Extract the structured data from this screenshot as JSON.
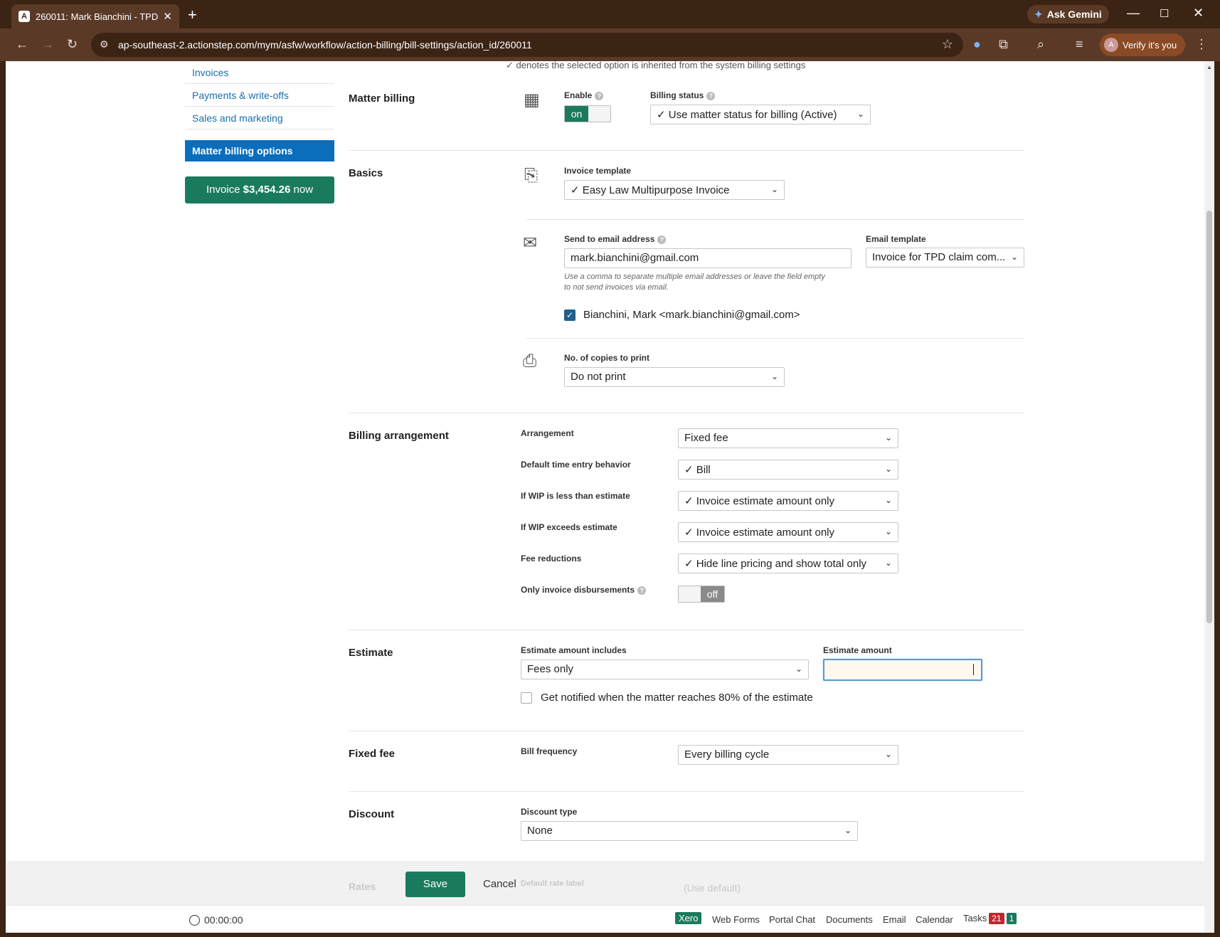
{
  "browser": {
    "tab_title": "260011: Mark Bianchini - TPD (",
    "url": "ap-southeast-2.actionstep.com/mym/asfw/workflow/action-billing/bill-settings/action_id/260011",
    "gemini_label": "Ask Gemini",
    "verify_label": "Verify it's you",
    "avatar_letter": "A"
  },
  "sidebar": {
    "items": [
      {
        "label": "Invoices"
      },
      {
        "label": "Payments & write-offs"
      },
      {
        "label": "Sales and marketing"
      },
      {
        "label": "Matter billing options"
      }
    ],
    "invoice_button": {
      "prefix": "Invoice ",
      "amount": "$3,454.26",
      "suffix": " now"
    }
  },
  "note": "✓ denotes the selected option is inherited from the system billing settings",
  "matter_billing": {
    "title": "Matter billing",
    "enable_label": "Enable",
    "enable_value": "on",
    "status_label": "Billing status",
    "status_value": "✓ Use matter status for billing (Active)"
  },
  "basics": {
    "title": "Basics",
    "template_label": "Invoice template",
    "template_value": "✓ Easy Law Multipurpose Invoice",
    "email_label": "Send to email address",
    "email_value": "mark.bianchini@gmail.com",
    "email_help_1": "Use a comma to separate multiple email addresses or leave the field empty",
    "email_help_2": "to not send invoices via email.",
    "email_template_label": "Email template",
    "email_template_value": "Invoice for TPD claim com...",
    "contact_checkbox": "Bianchini, Mark <mark.bianchini@gmail.com>",
    "copies_label": "No. of copies to print",
    "copies_value": "Do not print"
  },
  "billing_arrangement": {
    "title": "Billing arrangement",
    "rows": [
      {
        "label": "Arrangement",
        "value": "Fixed fee"
      },
      {
        "label": "Default time entry behavior",
        "value": "✓ Bill"
      },
      {
        "label": "If WIP is less than estimate",
        "value": "✓ Invoice estimate amount only"
      },
      {
        "label": "If WIP exceeds estimate",
        "value": "✓ Invoice estimate amount only"
      },
      {
        "label": "Fee reductions",
        "value": "✓ Hide line pricing and show total only"
      }
    ],
    "disb_label": "Only invoice disbursements",
    "disb_value": "off"
  },
  "estimate": {
    "title": "Estimate",
    "includes_label": "Estimate amount includes",
    "includes_value": "Fees only",
    "amount_label": "Estimate amount",
    "amount_value": "",
    "notify_label": "Get notified when the matter reaches 80% of the estimate"
  },
  "fixed_fee": {
    "title": "Fixed fee",
    "freq_label": "Bill frequency",
    "freq_value": "Every billing cycle"
  },
  "discount": {
    "title": "Discount",
    "type_label": "Discount type",
    "type_value": "None"
  },
  "rates_ghost": {
    "title": "Rates",
    "label": "Default rate label",
    "value": "(Use default)"
  },
  "footer": {
    "save": "Save",
    "cancel": "Cancel"
  },
  "statusbar": {
    "timer": "00:00:00",
    "xero": "Xero",
    "links": [
      "Web Forms",
      "Portal Chat",
      "Documents",
      "Email",
      "Calendar",
      "Tasks"
    ],
    "tasks_red": "21",
    "tasks_green": "1"
  }
}
